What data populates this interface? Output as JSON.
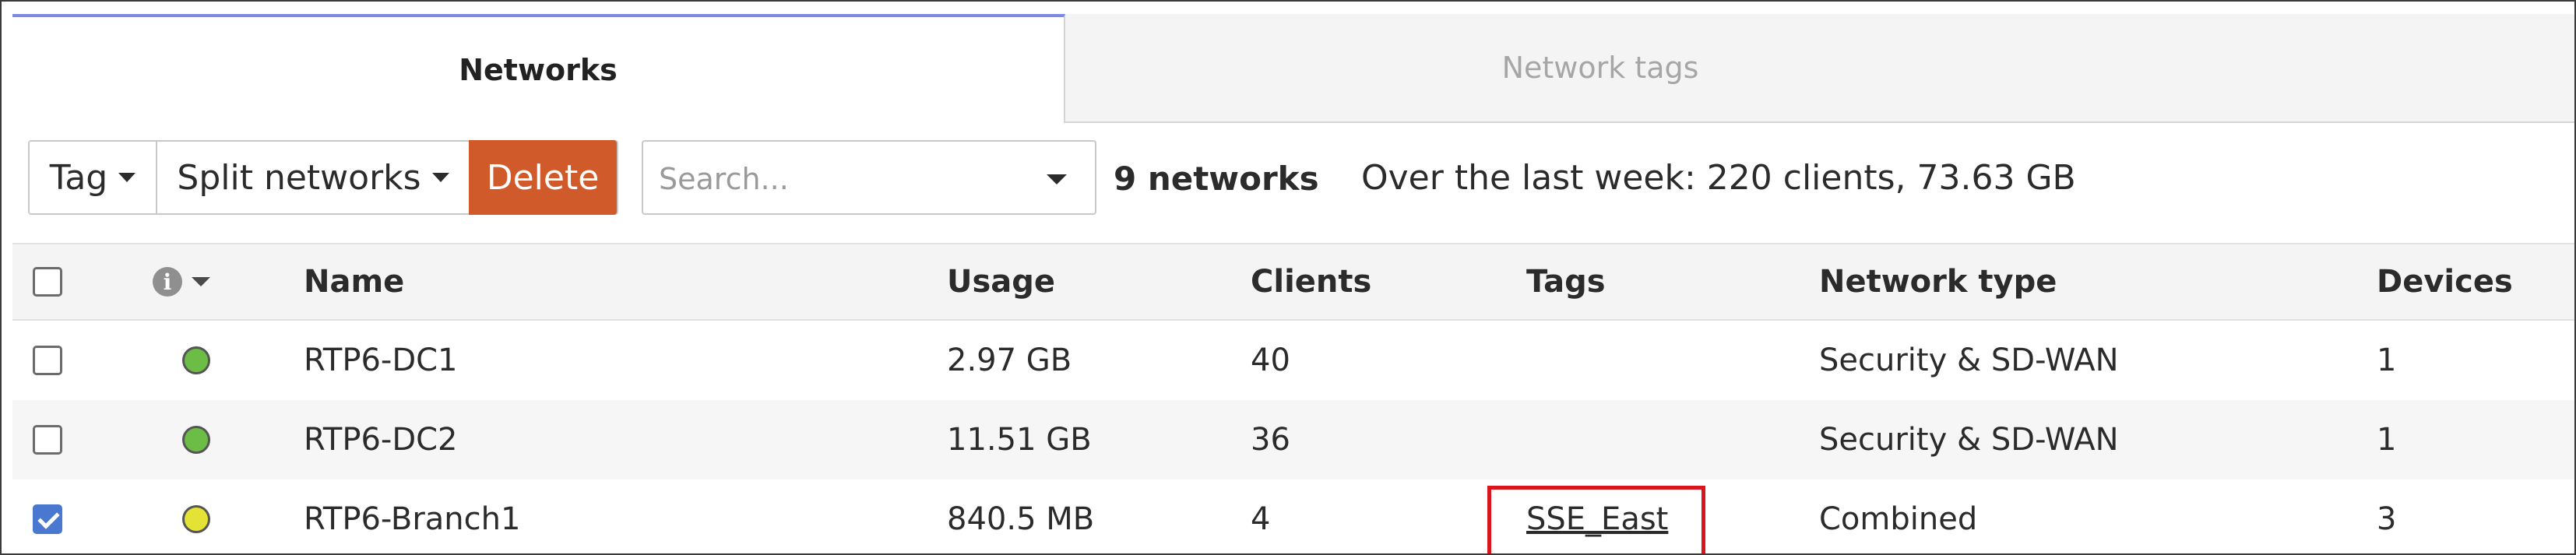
{
  "tabs": [
    {
      "label": "Networks",
      "active": true
    },
    {
      "label": "Network tags",
      "active": false
    }
  ],
  "toolbar": {
    "tag_label": "Tag",
    "split_label": "Split networks",
    "delete_label": "Delete"
  },
  "search": {
    "placeholder": "Search..."
  },
  "count_text": "9 networks",
  "summary_text": "Over the last week: 220 clients, 73.63 GB",
  "table": {
    "headers": {
      "name": "Name",
      "usage": "Usage",
      "clients": "Clients",
      "tags": "Tags",
      "network_type": "Network type",
      "devices": "Devices"
    },
    "rows": [
      {
        "checked": false,
        "status": "green",
        "name": "RTP6-DC1",
        "usage": "2.97 GB",
        "clients": "40",
        "tags": "",
        "network_type": "Security & SD-WAN",
        "devices": "1"
      },
      {
        "checked": false,
        "status": "green",
        "name": "RTP6-DC2",
        "usage": "11.51 GB",
        "clients": "36",
        "tags": "",
        "network_type": "Security & SD-WAN",
        "devices": "1"
      },
      {
        "checked": true,
        "status": "yellow",
        "name": "RTP6-Branch1",
        "usage": "840.5 MB",
        "clients": "4",
        "tags": "SSE_East",
        "network_type": "Combined",
        "devices": "3"
      }
    ]
  },
  "colors": {
    "accent_tab": "#7b89e8",
    "delete_button": "#d05a2a",
    "status_green": "#6cbd45",
    "status_yellow": "#e4e234",
    "checkbox_checked": "#4a78d0",
    "highlight": "#d9161c"
  },
  "icons": {
    "info": "info-icon",
    "caret": "chevron-down-icon"
  }
}
